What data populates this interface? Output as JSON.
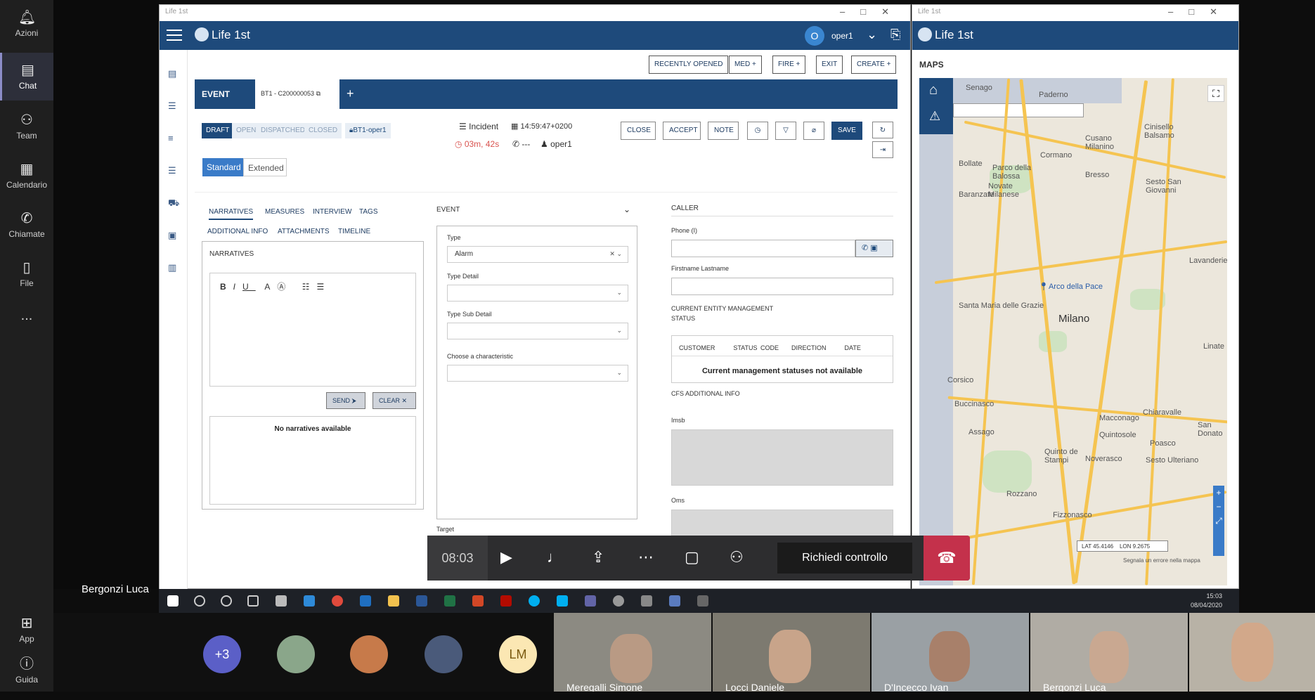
{
  "teams": {
    "rail": [
      {
        "label": "Azioni",
        "icon": "bell-icon"
      },
      {
        "label": "Chat",
        "icon": "chat-icon"
      },
      {
        "label": "Team",
        "icon": "team-icon"
      },
      {
        "label": "Calendario",
        "icon": "calendar-icon"
      },
      {
        "label": "Chiamate",
        "icon": "phone-icon"
      },
      {
        "label": "File",
        "icon": "file-icon"
      },
      {
        "label": "...",
        "icon": "more-icon"
      }
    ],
    "rail_bottom": [
      {
        "label": "App",
        "icon": "apps-icon"
      },
      {
        "label": "Guida",
        "icon": "help-icon"
      }
    ],
    "presenter_name": "Bergonzi Luca",
    "call": {
      "timer": "08:03",
      "request_control": "Richiedi controllo"
    },
    "participants_more": "+3",
    "participants_initials": "LM",
    "videos": [
      "Meregalli Simone",
      "Locci Daniele",
      "D'Incecco Ivan",
      "Bergonzi Luca"
    ]
  },
  "app": {
    "window_title": "Life 1st",
    "brand": "Life 1st",
    "user_initial": "O",
    "user": "oper1",
    "top_buttons": [
      "RECENTLY OPENED",
      "MED +",
      "FIRE +",
      "EXIT",
      "CREATE +"
    ],
    "event_header": "EVENT",
    "event_tab": "BT1 - C200000053",
    "add_tab": "+",
    "statuses": [
      "DRAFT",
      "OPEN",
      "DISPATCHED",
      "CLOSED"
    ],
    "lock_tag": "BT1-oper1",
    "event_type": "Incident",
    "event_time": "14:59:47+0200",
    "elapsed": "03m, 42s",
    "phone_meta": "---",
    "owner": "oper1",
    "actions": [
      "CLOSE",
      "ACCEPT",
      "NOTE"
    ],
    "save": "SAVE",
    "views": [
      "Standard",
      "Extended"
    ],
    "tabs_row1": [
      "NARRATIVES",
      "MEASURES",
      "INTERVIEW",
      "TAGS"
    ],
    "tabs_row2": [
      "ADDITIONAL INFO",
      "ATTACHMENTS",
      "TIMELINE"
    ],
    "narratives_title": "NARRATIVES",
    "send": "SEND ⮞",
    "clear": "CLEAR ✕",
    "no_narratives": "No narratives available",
    "event_section": "EVENT",
    "type_label": "Type",
    "type_value": "Alarm",
    "type_detail_label": "Type Detail",
    "type_sub_detail_label": "Type Sub Detail",
    "characteristic_label": "Choose a characteristic",
    "target_label": "Target",
    "caller_section": "CALLER",
    "phone_label": "Phone (I)",
    "name_label": "Firstname Lastname",
    "ems_label": "CURRENT ENTITY MANAGEMENT STATUS",
    "status_cols": [
      "CUSTOMER",
      "STATUS CODE",
      "DIRECTION",
      "DATE"
    ],
    "no_statuses": "Current management statuses not available",
    "cfs_label": "CFS ADDITIONAL INFO",
    "imsb_label": "Imsb",
    "oms_label": "Oms"
  },
  "maps": {
    "title": "MAPS",
    "towns": [
      "Senago",
      "Paderno",
      "Cinisello Balsamo",
      "Cusano Milanino",
      "Cormano",
      "Bollate",
      "Parco della Balossa",
      "Bresso",
      "Sesto San Giovanni",
      "Novate Milanese",
      "Baranzate",
      "Arco della Pace",
      "Santa Maria delle Grazie",
      "Milano",
      "Corsico",
      "Buccinasco",
      "Assago",
      "Rozzano",
      "Quinto de Stampi",
      "Noverasco",
      "Macconago",
      "Quintosole",
      "Chiaravalle",
      "Poasco",
      "Sesto Ulteriano",
      "San Donato",
      "Fizzonasco",
      "Lavanderie",
      "Linate"
    ],
    "coords": "LAT 45.4146    LON 9.2675",
    "footer": "Segnala un errore nella mappa"
  },
  "taskbar": {
    "time": "15:03",
    "date": "08/04/2020"
  }
}
